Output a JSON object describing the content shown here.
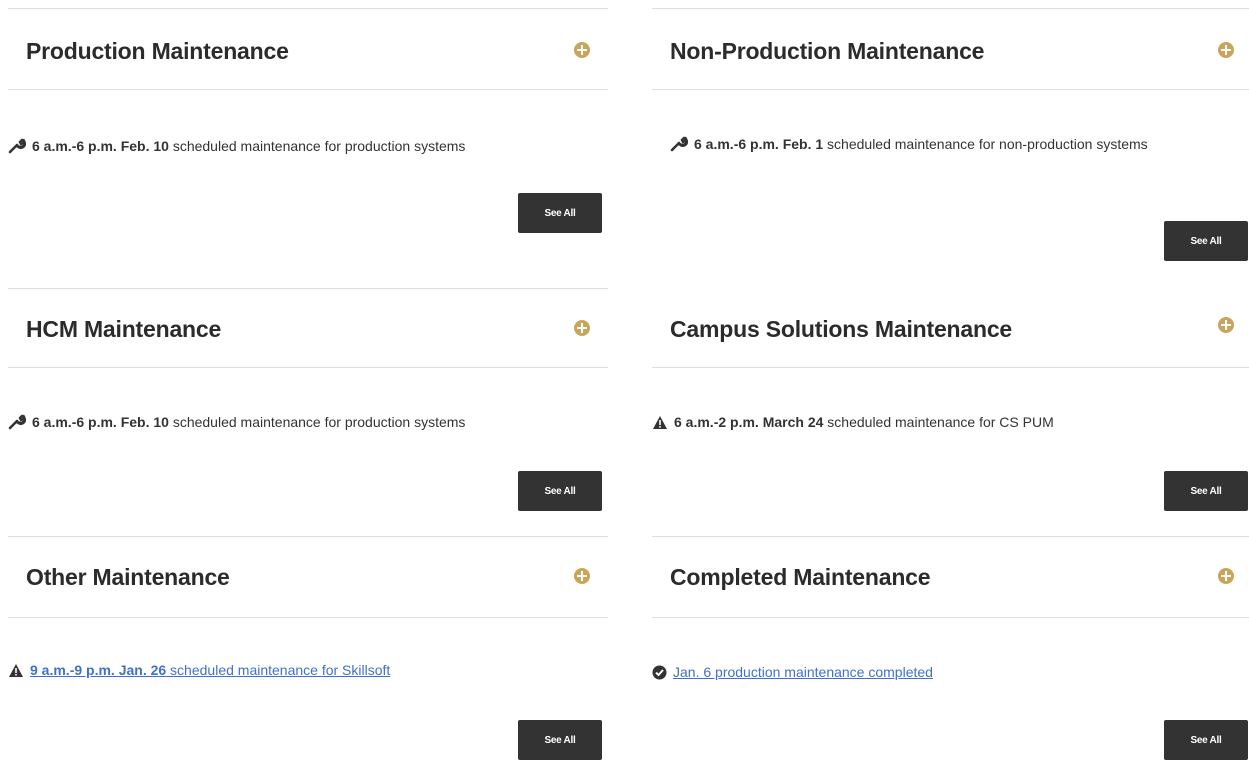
{
  "sections": [
    {
      "title": "Production Maintenance",
      "icon": "wrench-icon",
      "time": "6 a.m.-6 p.m. Feb. 10",
      "text": " scheduled maintenance for production systems",
      "see_all": "See All"
    },
    {
      "title": "Non-Production Maintenance",
      "icon": "wrench-icon",
      "time": "6 a.m.-6 p.m. Feb. 1",
      "text": " scheduled maintenance for non-production systems",
      "see_all": "See All"
    },
    {
      "title": "HCM Maintenance",
      "icon": "wrench-icon",
      "time": "6 a.m.-6 p.m. Feb. 10",
      "text": " scheduled maintenance for production systems",
      "see_all": "See All"
    },
    {
      "title": "Campus Solutions Maintenance",
      "icon": "warning-icon",
      "time": "6 a.m.-2 p.m. March 24",
      "text": " scheduled maintenance for CS PUM",
      "see_all": "See All"
    },
    {
      "title": "Other Maintenance",
      "icon": "warning-icon",
      "time": "9 a.m.-9 p.m. Jan. 26",
      "text": " scheduled maintenance for Skillsoft",
      "see_all": "See All"
    },
    {
      "title": "Completed Maintenance",
      "icon": "check-circle-icon",
      "time": "",
      "text": "Jan. 6 production maintenance completed",
      "see_all": "See All"
    }
  ],
  "colors": {
    "accent": "#c9a55c",
    "link": "#3f71c9",
    "button": "#333333",
    "divider": "#dedede"
  }
}
